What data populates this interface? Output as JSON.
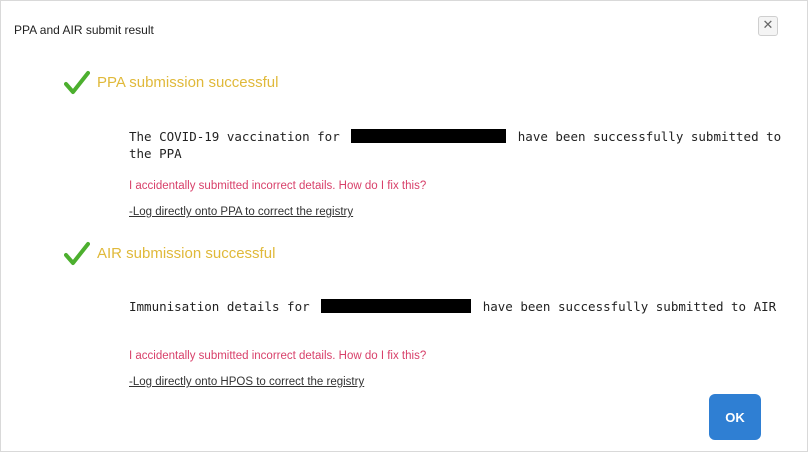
{
  "dialog": {
    "title": "PPA and AIR submit result",
    "close_label": "✕"
  },
  "ppa": {
    "heading": "PPA submission successful",
    "message_before": "The COVID-19 vaccination for",
    "message_after": "have been successfully submitted to",
    "message_line2": "the PPA",
    "question": "I accidentally submitted incorrect details. How do I fix this?",
    "fix_link": "-Log directly onto PPA to correct the registry"
  },
  "air": {
    "heading": "AIR submission successful",
    "message_before": "Immunisation details for",
    "message_after": "have been successfully submitted to AIR",
    "question": "I accidentally submitted incorrect details. How do I fix this?",
    "fix_link": "-Log directly onto HPOS to correct the registry"
  },
  "ok_label": "OK",
  "colors": {
    "heading": "#e0b93a",
    "check": "#4caf2e",
    "question": "#d8406a",
    "ok_button": "#2f7fd3"
  },
  "icons": {
    "check": "checkmark-icon",
    "close": "close-icon"
  }
}
